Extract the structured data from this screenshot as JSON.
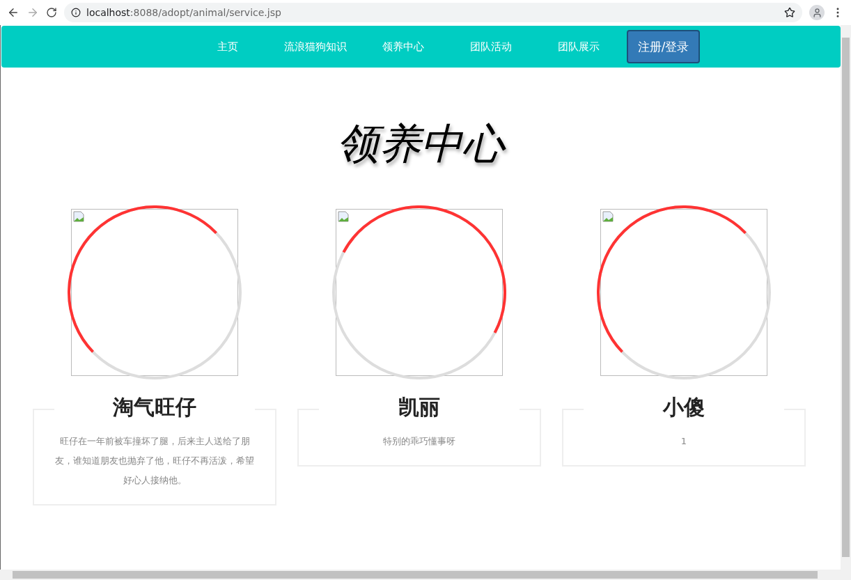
{
  "browser": {
    "url_host": "localhost",
    "url_rest": ":8088/adopt/animal/service.jsp"
  },
  "nav": {
    "items": [
      {
        "label": "主页"
      },
      {
        "label": "流浪猫狗知识"
      },
      {
        "label": "领养中心"
      },
      {
        "label": "团队活动"
      },
      {
        "label": "团队展示"
      }
    ],
    "login_button": "注册/登录"
  },
  "heading": "领养中心",
  "pets": [
    {
      "name": "淘气旺仔",
      "description": "旺仔在一年前被车撞坏了腿，后来主人送给了朋友，谁知道朋友也抛弃了他，旺仔不再活泼，希望好心人接纳他。"
    },
    {
      "name": "凯丽",
      "description": "特别的乖巧懂事呀"
    },
    {
      "name": "小傻",
      "description": "1"
    }
  ]
}
